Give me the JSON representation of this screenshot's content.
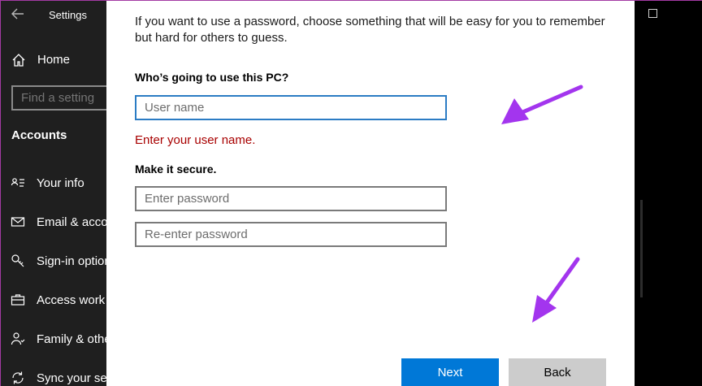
{
  "app": {
    "title": "Settings"
  },
  "sidebar": {
    "home_label": "Home",
    "search_placeholder": "Find a setting",
    "section_title": "Accounts",
    "items": [
      {
        "label": "Your info",
        "icon": "person-card-icon"
      },
      {
        "label": "Email & accounts",
        "icon": "mail-icon"
      },
      {
        "label": "Sign-in options",
        "icon": "key-icon"
      },
      {
        "label": "Access work or school",
        "icon": "briefcase-icon"
      },
      {
        "label": "Family & other users",
        "icon": "people-icon"
      },
      {
        "label": "Sync your settings",
        "icon": "sync-icon"
      }
    ]
  },
  "dialog": {
    "intro_line1": "If you want to use a password, choose something that will be easy for you to remember",
    "intro_line2": "but hard for others to guess.",
    "question": "Who’s going to use this PC?",
    "username_placeholder": "User name",
    "username_value": "",
    "error": "Enter your user name.",
    "secure_heading": "Make it secure.",
    "password_placeholder": "Enter password",
    "reenter_placeholder": "Re-enter password",
    "next_label": "Next",
    "back_label": "Back"
  },
  "colors": {
    "sidebar_bg": "#1f1f1f",
    "accent": "#0078d7",
    "error": "#a80000",
    "annotation_arrow": "#a335ee"
  }
}
